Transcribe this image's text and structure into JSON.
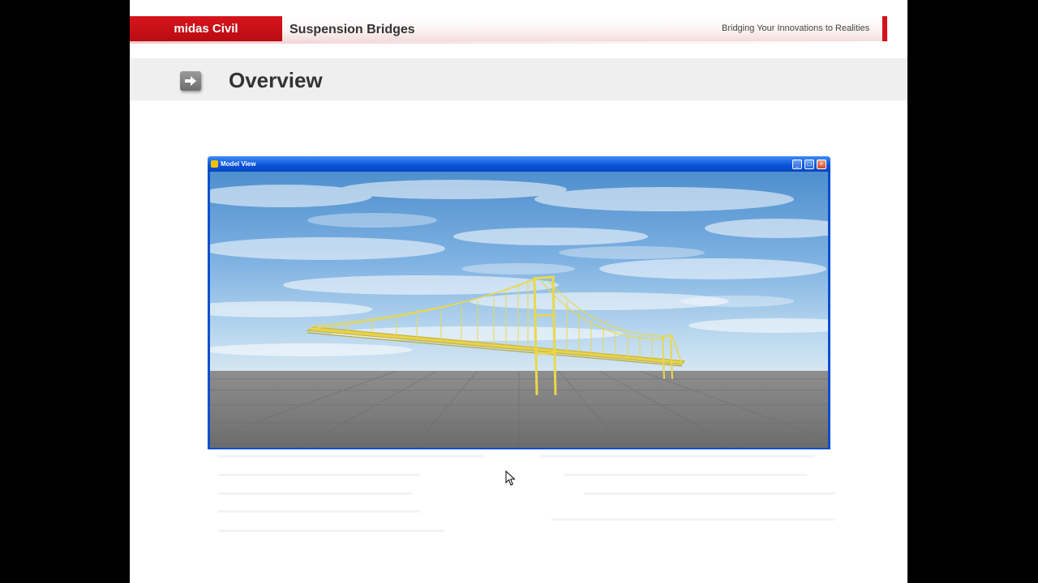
{
  "header": {
    "brand": "midas Civil",
    "deck_title": "Suspension Bridges",
    "tagline": "Bridging Your Innovations to Realities",
    "accent_color": "#d3121a"
  },
  "section": {
    "icon": "arrow-right-icon",
    "title": "Overview"
  },
  "model_view": {
    "title": "Model View",
    "controls": [
      "minimize",
      "maximize",
      "close"
    ],
    "scene": "3D model of a yellow suspension bridge over a gray grid ground with a cloudy sky"
  },
  "colors": {
    "bridge": "#e9d84a",
    "window_frame": "#0a4fd0"
  }
}
